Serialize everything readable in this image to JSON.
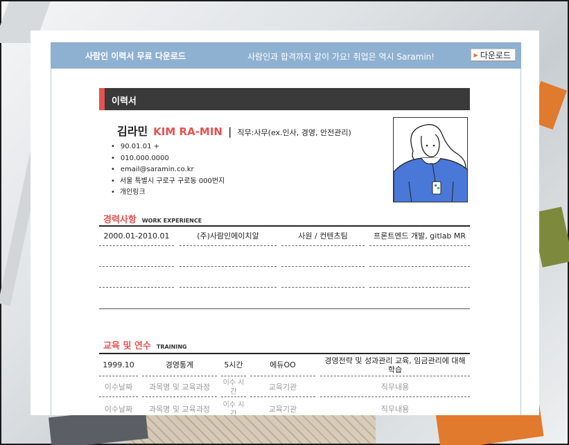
{
  "banner": {
    "left_text": "사람인 이력서 무료 다운로드",
    "right_text": "사람인과 합격까지 같이 가요! 취업은 역시 Saramin!",
    "download_label": "다운로드"
  },
  "resume": {
    "title": "이력서",
    "name_ko": "김라민",
    "name_en": "KIM RA-MIN",
    "separator": "|",
    "job": "직무:사무(ex.인사, 경영, 안전관리)",
    "info": [
      "90.01.01 +",
      "010.000.0000",
      "email@saramin.co.kr",
      "서울 특별시 구로구 구로동 000번지",
      "개인링크"
    ]
  },
  "experience": {
    "title_ko": "경력사항",
    "title_en": "WORK EXPERIENCE",
    "rows": [
      [
        "2000.01-2010.01",
        "(주)사람인에이치알",
        "사원 / 컨텐츠팀",
        "프론트엔드 개발, gitlab MR"
      ],
      [
        "",
        "",
        "",
        ""
      ],
      [
        "",
        "",
        "",
        ""
      ]
    ]
  },
  "training": {
    "title_ko": "교육 및 연수",
    "title_en": "TRAINING",
    "rows": [
      [
        "1999.10",
        "경영통계",
        "5시간",
        "에듀OO",
        "경영전략 및 성과관리 교육, 임금관리에 대해 학습"
      ],
      [
        "이수날짜",
        "과목명 및 교육과정",
        "이수 시간",
        "교육기관",
        "직무내용"
      ],
      [
        "이수날짜",
        "과목명 및 교육과정",
        "이수 시간",
        "교육기관",
        "직무내용"
      ]
    ]
  },
  "colors": {
    "accent": "#e8514f",
    "banner": "#8fb1d1",
    "title_bar": "#3a3a3a",
    "photo_shirt": "#4a78d8"
  }
}
